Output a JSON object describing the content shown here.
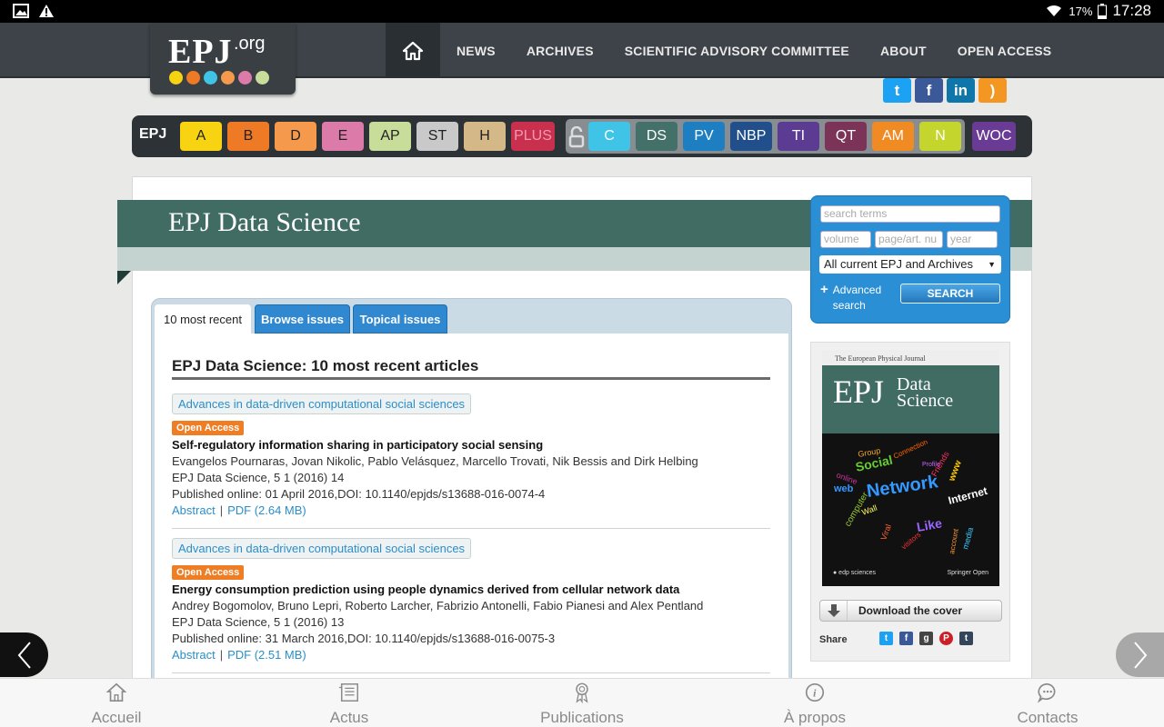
{
  "status_bar": {
    "battery": "17%",
    "time": "17:28"
  },
  "site": {
    "logo_main": "EPJ",
    "logo_suffix": ".org"
  },
  "nav": {
    "items": [
      "NEWS",
      "ARCHIVES",
      "SCIENTIFIC ADVISORY COMMITTEE",
      "ABOUT",
      "OPEN ACCESS"
    ]
  },
  "social": [
    {
      "name": "twitter",
      "glyph": "t",
      "color": "#1da1f2"
    },
    {
      "name": "facebook",
      "glyph": "f",
      "color": "#3b5998"
    },
    {
      "name": "linkedin",
      "glyph": "in",
      "color": "#0e76a8"
    },
    {
      "name": "rss",
      "glyph": "))",
      "color": "#f39622"
    }
  ],
  "journals": {
    "label": "EPJ",
    "group1": [
      {
        "label": "A",
        "bg": "#f7d312",
        "fg": "#222"
      },
      {
        "label": "B",
        "bg": "#ef7a25",
        "fg": "#222"
      },
      {
        "label": "D",
        "bg": "#f59a4c",
        "fg": "#222"
      },
      {
        "label": "E",
        "bg": "#dc7ba9",
        "fg": "#222"
      },
      {
        "label": "AP",
        "bg": "#c9dd9a",
        "fg": "#222"
      },
      {
        "label": "ST",
        "bg": "#c9c9c9",
        "fg": "#222"
      },
      {
        "label": "H",
        "bg": "#d5b888",
        "fg": "#222"
      },
      {
        "label": "PLUS",
        "bg": "#c9304d",
        "fg": "#f39ab1"
      }
    ],
    "group2": [
      {
        "label": "C",
        "bg": "#3fc4e8",
        "fg": "#fff"
      },
      {
        "label": "DS",
        "bg": "#44706a",
        "fg": "#fff"
      },
      {
        "label": "PV",
        "bg": "#1d7fc2",
        "fg": "#fff"
      },
      {
        "label": "NBP",
        "bg": "#214f8c",
        "fg": "#fff"
      },
      {
        "label": "TI",
        "bg": "#5b3c92",
        "fg": "#fff"
      },
      {
        "label": "QT",
        "bg": "#7b3458",
        "fg": "#fff"
      },
      {
        "label": "AM",
        "bg": "#f08a23",
        "fg": "#fff"
      },
      {
        "label": "N",
        "bg": "#c4d62e",
        "fg": "#fff"
      }
    ],
    "woc": {
      "label": "WOC",
      "bg": "#6a3b94",
      "fg": "#fff"
    }
  },
  "banner": {
    "title": "EPJ Data Science"
  },
  "tabs": [
    "10 most recent",
    "Browse issues",
    "Topical issues"
  ],
  "section_title": "EPJ Data Science: 10 most recent articles",
  "articles": [
    {
      "category": "Advances in data-driven computational social sciences",
      "badge": "Open Access",
      "title": "Self-regulatory information sharing in participatory social sensing",
      "authors": "Evangelos Pournaras, Jovan Nikolic, Pablo Velásquez, Marcello Trovati, Nik Bessis and Dirk Helbing",
      "citation": "EPJ Data Science, 5 1 (2016) 14",
      "published": "Published online: 01 April 2016,DOI: 10.1140/epjds/s13688-016-0074-4",
      "abstract_link": "Abstract",
      "pdf_link": "PDF (2.64 MB)"
    },
    {
      "category": "Advances in data-driven computational social sciences",
      "badge": "Open Access",
      "title": "Energy consumption prediction using people dynamics derived from cellular network data",
      "authors": "Andrey Bogomolov, Bruno Lepri, Roberto Larcher, Fabrizio Antonelli, Fabio Pianesi and Alex Pentland",
      "citation": "EPJ Data Science, 5 1 (2016) 13",
      "published": "Published online: 31 March 2016,DOI: 10.1140/epjds/s13688-016-0075-3",
      "abstract_link": "Abstract",
      "pdf_link": "PDF (2.51 MB)"
    }
  ],
  "search": {
    "terms_placeholder": "search terms",
    "volume_placeholder": "volume",
    "page_placeholder": "page/art. nu",
    "year_placeholder": "year",
    "scope": "All current EPJ and Archives",
    "advanced": "Advanced search",
    "button": "SEARCH"
  },
  "cover": {
    "top_text": "The European Physical Journal",
    "epj": "EPJ",
    "ds_line1": "Data",
    "ds_line2": "Science",
    "download_label": "Download the cover",
    "share_label": "Share"
  },
  "share_icons": [
    {
      "name": "twitter",
      "glyph": "t",
      "color": "#1da1f2"
    },
    {
      "name": "facebook",
      "glyph": "f",
      "color": "#3b5998"
    },
    {
      "name": "googleplus",
      "glyph": "g+",
      "color": "#444"
    },
    {
      "name": "pinterest",
      "glyph": "P",
      "color": "#cb2027"
    },
    {
      "name": "tumblr",
      "glyph": "t",
      "color": "#35465c"
    }
  ],
  "bottom_nav": [
    "Accueil",
    "Actus",
    "Publications",
    "À propos",
    "Contacts"
  ]
}
